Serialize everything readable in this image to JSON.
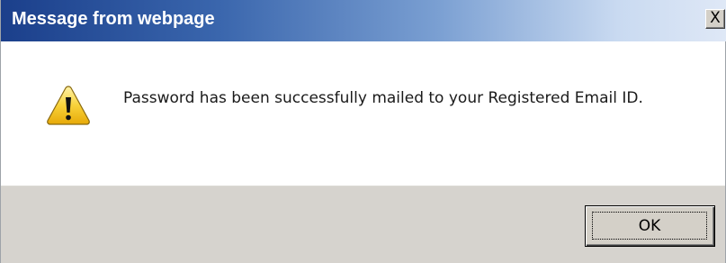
{
  "dialog": {
    "title": "Message from webpage",
    "close_label": "X",
    "message": "Password has been successfully mailed to your Registered Email ID.",
    "icon": "warning-icon",
    "ok_label": "OK"
  },
  "colors": {
    "titlebar_start": "#1b3f8b",
    "titlebar_end": "#dfe8f6",
    "footer_bg": "#d6d3ce",
    "warning_yellow": "#f5c21b"
  }
}
